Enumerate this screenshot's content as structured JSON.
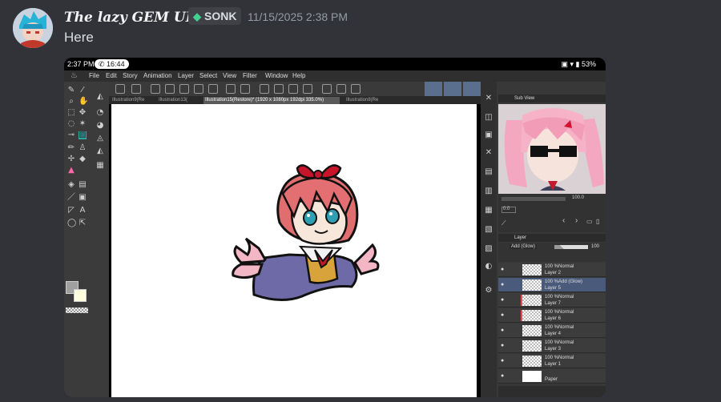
{
  "message": {
    "author": "The lazy GEM UI",
    "tag": "SONK",
    "tag_icon": "gem-icon",
    "timestamp": "11/15/2025 2:38 PM",
    "text": "Here"
  },
  "screenshot": {
    "status": {
      "time": "2:37 PM",
      "call": "16:44",
      "battery": "53%"
    },
    "menu": [
      "File",
      "Edit",
      "Story",
      "Animation",
      "Layer",
      "Select",
      "View",
      "Filter",
      "Window",
      "Help"
    ],
    "tabs": [
      "Illustration9(Re",
      "Illustration13(",
      "Illustration15(Restore)* (1920 x 1080px 192dpi 335.0%)",
      "Illustration8(Re"
    ],
    "subview": {
      "title": "Sub View",
      "zoom": "100.0",
      "pos": "0.0"
    },
    "layer_panel": {
      "title": "Layer",
      "blend_mode": "Add (Glow)",
      "opacity": "100",
      "layers": [
        {
          "line1": "100 %Normal",
          "line2": "Layer 2"
        },
        {
          "line1": "100 %Add (Glow)",
          "line2": "Layer 5"
        },
        {
          "line1": "100 %Normal",
          "line2": "Layer 7"
        },
        {
          "line1": "100 %Normal",
          "line2": "Layer 6"
        },
        {
          "line1": "100 %Normal",
          "line2": "Layer 4"
        },
        {
          "line1": "100 %Normal",
          "line2": "Layer 3"
        },
        {
          "line1": "100 %Normal",
          "line2": "Layer 1"
        },
        {
          "line1": "",
          "line2": "Paper"
        }
      ]
    }
  },
  "colors": {
    "discord_bg": "#313338",
    "accent_selected": "#5a6f8e",
    "primary_color": "#a0a0a0",
    "secondary_color": "#fffce0"
  }
}
